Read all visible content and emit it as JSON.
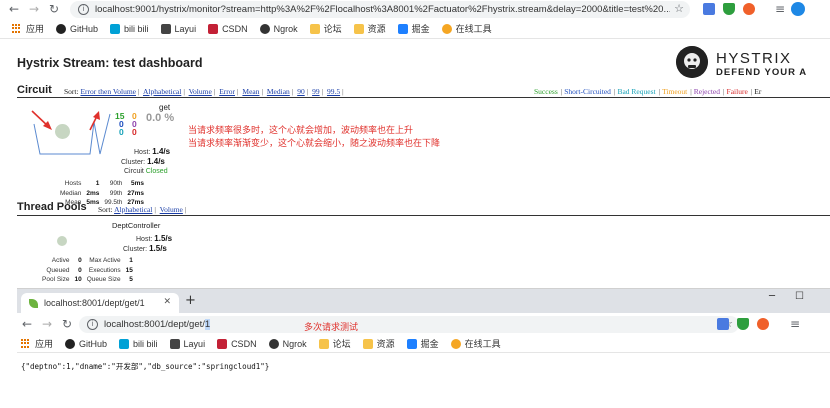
{
  "browser": {
    "url": "localhost:9001/hystrix/monitor?stream=http%3A%2F%2Flocalhost%3A8001%2Factuator%2Fhystrix.stream&delay=2000&title=test%20...",
    "bookmarks": [
      {
        "label": "应用",
        "icon": "apps-grid-icon"
      },
      {
        "label": "GitHub",
        "icon": "github-icon"
      },
      {
        "label": "bili bili",
        "icon": "bilibili-icon"
      },
      {
        "label": "Layui",
        "icon": "layui-icon"
      },
      {
        "label": "CSDN",
        "icon": "csdn-icon"
      },
      {
        "label": "Ngrok",
        "icon": "ngrok-icon"
      },
      {
        "label": "论坛",
        "icon": "folder-icon"
      },
      {
        "label": "资源",
        "icon": "folder-icon"
      },
      {
        "label": "掘金",
        "icon": "juejin-icon"
      },
      {
        "label": "在线工具",
        "icon": "online-tools-icon"
      }
    ]
  },
  "dashboard": {
    "title": "Hystrix Stream: test dashboard",
    "logo_title": "HYSTRIX",
    "logo_subtitle": "DEFEND YOUR A",
    "circuit": {
      "heading": "Circuit",
      "sort_label": "Sort:",
      "sort_options": [
        "Error then Volume",
        "Alphabetical",
        "Volume",
        "Error",
        "Mean",
        "Median",
        "90",
        "99",
        "99.5"
      ],
      "legend": [
        {
          "label": "Success",
          "color": "#2ca02c"
        },
        {
          "label": "Short-Circuited",
          "color": "#1f4fbf"
        },
        {
          "label": "Bad Request",
          "color": "#17a2b8"
        },
        {
          "label": "Timeout",
          "color": "#f0a020"
        },
        {
          "label": "Rejected",
          "color": "#8e44ad"
        },
        {
          "label": "Failure",
          "color": "#d62728"
        },
        {
          "label": "Er",
          "color": "#222222"
        }
      ],
      "card": {
        "name": "get",
        "error_pct": "0.0 %",
        "counts": [
          {
            "value": "15",
            "color": "#2ca02c"
          },
          {
            "value": "0",
            "color": "#1f4fbf"
          },
          {
            "value": "0",
            "color": "#17a2b8"
          },
          {
            "value": "0",
            "color": "#f0a020"
          },
          {
            "value": "0",
            "color": "#8e44ad"
          },
          {
            "value": "0",
            "color": "#d62728"
          }
        ],
        "host_label": "Host:",
        "host_rate": "1.4/s",
        "cluster_label": "Cluster:",
        "cluster_rate": "1.4/s",
        "circuit_label": "Circuit",
        "circuit_status": "Closed",
        "stats": [
          [
            "Hosts",
            "1",
            "90th",
            "5ms"
          ],
          [
            "Median",
            "2ms",
            "99th",
            "27ms"
          ],
          [
            "Mean",
            "5ms",
            "99.5th",
            "27ms"
          ]
        ]
      }
    },
    "annotation": [
      "当请求频率很多时，这个心就会增加，波动频率也在上升",
      "当请求频率渐渐变少，这个心就会缩小，随之波动频率也在下降"
    ],
    "thread_pools": {
      "heading": "Thread Pools",
      "sort_label": "Sort:",
      "sort_options": [
        "Alphabetical",
        "Volume"
      ],
      "card": {
        "name": "DeptController",
        "host_label": "Host:",
        "host_rate": "1.5/s",
        "cluster_label": "Cluster:",
        "cluster_rate": "1.5/s",
        "stats": [
          [
            "Active",
            "0",
            "Max Active",
            "1"
          ],
          [
            "Queued",
            "0",
            "Executions",
            "15"
          ],
          [
            "Pool Size",
            "10",
            "Queue Size",
            "5"
          ]
        ]
      }
    }
  },
  "second_window": {
    "tab_title": "localhost:8001/dept/get/1",
    "url_prefix": "localhost:8001/dept/get/",
    "url_selected": "1",
    "annotation": "多次请求测试",
    "bookmarks": [
      {
        "label": "应用",
        "icon": "apps-grid-icon"
      },
      {
        "label": "GitHub",
        "icon": "github-icon"
      },
      {
        "label": "bili bili",
        "icon": "bilibili-icon"
      },
      {
        "label": "Layui",
        "icon": "layui-icon"
      },
      {
        "label": "CSDN",
        "icon": "csdn-icon"
      },
      {
        "label": "Ngrok",
        "icon": "ngrok-icon"
      },
      {
        "label": "论坛",
        "icon": "folder-icon"
      },
      {
        "label": "资源",
        "icon": "folder-icon"
      },
      {
        "label": "掘金",
        "icon": "juejin-icon"
      },
      {
        "label": "在线工具",
        "icon": "online-tools-icon"
      }
    ],
    "body_json": "{\"deptno\":1,\"dname\":\"开发部\",\"db_source\":\"springcloud1\"}"
  }
}
